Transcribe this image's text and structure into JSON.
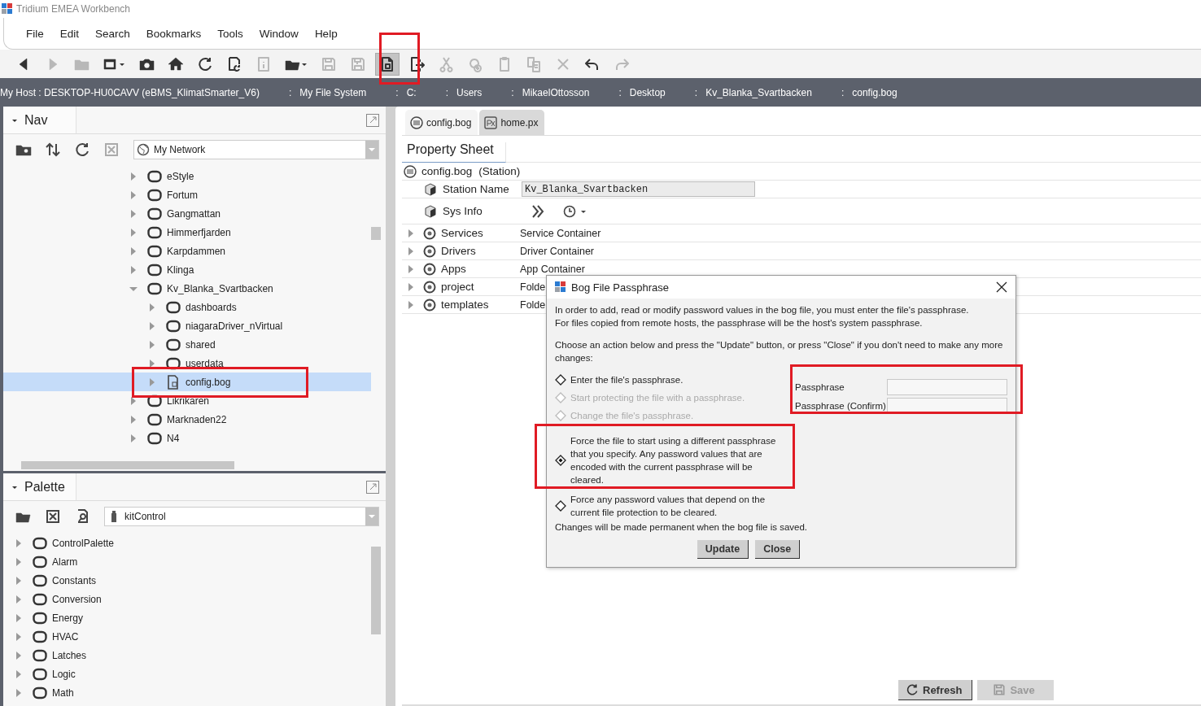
{
  "window": {
    "title": "Tridium EMEA Workbench"
  },
  "menu": [
    "File",
    "Edit",
    "Search",
    "Bookmarks",
    "Tools",
    "Window",
    "Help"
  ],
  "toolbar": [
    {
      "kind": "back",
      "disabled": false,
      "selected": false
    },
    {
      "kind": "forward",
      "disabled": true,
      "selected": false
    },
    {
      "kind": "parent-folder",
      "disabled": true,
      "selected": false
    },
    {
      "kind": "window-menu",
      "disabled": false,
      "selected": false
    },
    {
      "kind": "camera",
      "disabled": false,
      "selected": false
    },
    {
      "kind": "home",
      "disabled": false,
      "selected": false
    },
    {
      "kind": "refresh",
      "disabled": false,
      "selected": false
    },
    {
      "kind": "refresh-page",
      "disabled": false,
      "selected": false
    },
    {
      "kind": "info",
      "disabled": true,
      "selected": false
    },
    {
      "kind": "open-folder",
      "disabled": false,
      "selected": false
    },
    {
      "kind": "save",
      "disabled": true,
      "selected": false
    },
    {
      "kind": "save-all",
      "disabled": true,
      "selected": false
    },
    {
      "kind": "edit-file",
      "disabled": false,
      "selected": true
    },
    {
      "kind": "export",
      "disabled": false,
      "selected": false
    },
    {
      "kind": "cut",
      "disabled": true,
      "selected": false
    },
    {
      "kind": "duplicate",
      "disabled": true,
      "selected": false
    },
    {
      "kind": "paste",
      "disabled": true,
      "selected": false
    },
    {
      "kind": "copy",
      "disabled": true,
      "selected": false
    },
    {
      "kind": "delete",
      "disabled": true,
      "selected": false
    },
    {
      "kind": "undo",
      "disabled": false,
      "selected": false
    },
    {
      "kind": "redo",
      "disabled": true,
      "selected": false
    }
  ],
  "path_bar": {
    "separator": ":",
    "items": [
      "My Host : DESKTOP-HU0CAVV (eBMS_KlimatSmarter_V6)",
      "My File System",
      "C:",
      "Users",
      "MikaelOttosson",
      "Desktop",
      "Kv_Blanka_Svartbacken",
      "config.bog"
    ]
  },
  "nav": {
    "title": "Nav",
    "tools": [
      {
        "kind": "new-folder",
        "disabled": false
      },
      {
        "kind": "sort",
        "disabled": false
      },
      {
        "kind": "refresh",
        "disabled": false
      },
      {
        "kind": "close",
        "disabled": true
      }
    ],
    "selector": "My Network",
    "tree": [
      {
        "label": "eStyle",
        "kind": "folder",
        "expanded": false,
        "selected": false
      },
      {
        "label": "Fortum",
        "kind": "folder",
        "expanded": false,
        "selected": false
      },
      {
        "label": "Gangmattan",
        "kind": "folder",
        "expanded": false,
        "selected": false
      },
      {
        "label": "Himmerfjarden",
        "kind": "folder",
        "expanded": false,
        "selected": false
      },
      {
        "label": "Karpdammen",
        "kind": "folder",
        "expanded": false,
        "selected": false
      },
      {
        "label": "Klinga",
        "kind": "folder",
        "expanded": false,
        "selected": false
      },
      {
        "label": "Kv_Blanka_Svartbacken",
        "kind": "folder",
        "expanded": true,
        "selected": false,
        "children": [
          {
            "label": "dashboards",
            "kind": "folder",
            "expanded": false,
            "selected": false
          },
          {
            "label": "niagaraDriver_nVirtual",
            "kind": "folder",
            "expanded": false,
            "selected": false
          },
          {
            "label": "shared",
            "kind": "folder",
            "expanded": false,
            "selected": false
          },
          {
            "label": "userdata",
            "kind": "folder",
            "expanded": false,
            "selected": false
          },
          {
            "label": "config.bog",
            "kind": "bog",
            "expanded": false,
            "selected": true
          }
        ]
      },
      {
        "label": "Likrikaren",
        "kind": "folder",
        "expanded": false,
        "selected": false
      },
      {
        "label": "Marknaden22",
        "kind": "folder",
        "expanded": false,
        "selected": false
      },
      {
        "label": "N4",
        "kind": "folder",
        "expanded": false,
        "selected": false
      }
    ]
  },
  "palette": {
    "title": "Palette",
    "tools": [
      {
        "kind": "open-folder",
        "disabled": false
      },
      {
        "kind": "close",
        "disabled": false
      },
      {
        "kind": "find",
        "disabled": false
      }
    ],
    "selector": "kitControl",
    "tree": [
      {
        "label": "ControlPalette",
        "kind": "folder",
        "expanded": false,
        "selected": false
      },
      {
        "label": "Alarm",
        "kind": "folder",
        "expanded": false,
        "selected": false
      },
      {
        "label": "Constants",
        "kind": "folder",
        "expanded": false,
        "selected": false
      },
      {
        "label": "Conversion",
        "kind": "folder",
        "expanded": false,
        "selected": false
      },
      {
        "label": "Energy",
        "kind": "folder",
        "expanded": false,
        "selected": false
      },
      {
        "label": "HVAC",
        "kind": "folder",
        "expanded": false,
        "selected": false
      },
      {
        "label": "Latches",
        "kind": "folder",
        "expanded": false,
        "selected": false
      },
      {
        "label": "Logic",
        "kind": "folder",
        "expanded": false,
        "selected": false
      },
      {
        "label": "Math",
        "kind": "folder",
        "expanded": false,
        "selected": false
      }
    ]
  },
  "tabs": [
    {
      "label": "config.bog",
      "kind": "bog",
      "selected": true
    },
    {
      "label": "home.px",
      "kind": "px",
      "selected": false
    }
  ],
  "property_sheet": {
    "title": "Property Sheet",
    "root": {
      "name": "config.bog",
      "type": "(Station)"
    },
    "rows": [
      {
        "kind": "field",
        "name": "Station Name",
        "value": "Kv_Blanka_Svartbacken"
      },
      {
        "kind": "action",
        "name": "Sys Info"
      },
      {
        "kind": "container",
        "name": "Services",
        "value": "Service Container",
        "expanded": false
      },
      {
        "kind": "container",
        "name": "Drivers",
        "value": "Driver Container",
        "expanded": false
      },
      {
        "kind": "container",
        "name": "Apps",
        "value": "App Container",
        "expanded": false
      },
      {
        "kind": "container",
        "name": "project",
        "value": "Folde",
        "expanded": false
      },
      {
        "kind": "container",
        "name": "templates",
        "value": "Folde",
        "expanded": false
      }
    ]
  },
  "footer_buttons": [
    {
      "label": "Refresh",
      "kind": "refresh",
      "disabled": false
    },
    {
      "label": "Save",
      "kind": "save",
      "disabled": true
    }
  ],
  "dialog": {
    "title": "Bog File Passphrase",
    "intro": [
      "In order to add, read or modify password values in the bog file, you must enter the file's passphrase.",
      "For files copied from remote hosts, the passphrase will be the host's system passphrase."
    ],
    "instruction": "Choose an action below and press the \"Update\" button, or press \"Close\" if you don't need to make any more changes:",
    "options": [
      {
        "label": "Enter the file's passphrase.",
        "selected": false,
        "disabled": false
      },
      {
        "label": "Start protecting the file with a passphrase.",
        "selected": false,
        "disabled": true
      },
      {
        "label": "Change the file's passphrase.",
        "selected": false,
        "disabled": true
      },
      {
        "label": "Force the file to start using a different passphrase that you specify. Any password values that are encoded with the current passphrase will be cleared.",
        "selected": true,
        "disabled": false
      },
      {
        "label": "Force any password values that depend on the current file protection to be cleared.",
        "selected": false,
        "disabled": false
      }
    ],
    "fields": [
      {
        "label": "Passphrase"
      },
      {
        "label": "Passphrase (Confirm)"
      }
    ],
    "note": "Changes will be made permanent when the bog file is saved.",
    "buttons": [
      "Update",
      "Close"
    ]
  }
}
